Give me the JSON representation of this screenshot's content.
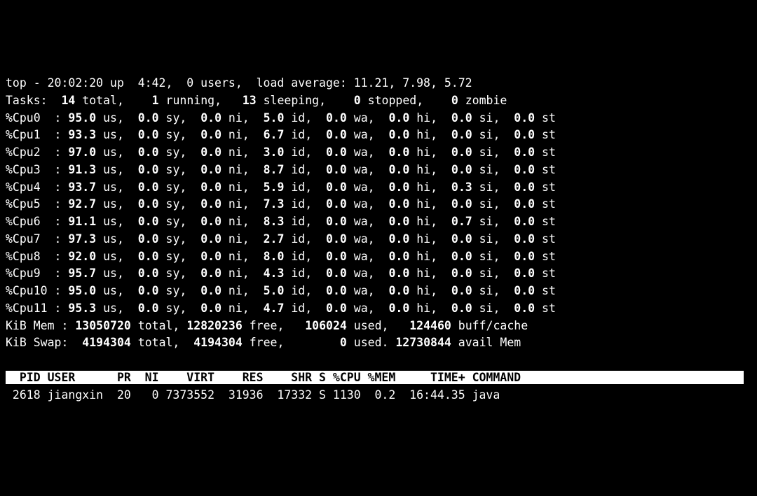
{
  "top_line": {
    "time": "20:02:20",
    "uptime": "4:42",
    "users": "0",
    "load1": "11.21",
    "load5": "7.98",
    "load15": "5.72"
  },
  "tasks": {
    "total": "14",
    "running": "1",
    "sleeping": "13",
    "stopped": "0",
    "zombie": "0"
  },
  "cpus": [
    {
      "name": "%Cpu0 ",
      "us": "95.0",
      "sy": "0.0",
      "ni": "0.0",
      "id": "5.0",
      "wa": "0.0",
      "hi": "0.0",
      "si": "0.0",
      "st": "0.0"
    },
    {
      "name": "%Cpu1 ",
      "us": "93.3",
      "sy": "0.0",
      "ni": "0.0",
      "id": "6.7",
      "wa": "0.0",
      "hi": "0.0",
      "si": "0.0",
      "st": "0.0"
    },
    {
      "name": "%Cpu2 ",
      "us": "97.0",
      "sy": "0.0",
      "ni": "0.0",
      "id": "3.0",
      "wa": "0.0",
      "hi": "0.0",
      "si": "0.0",
      "st": "0.0"
    },
    {
      "name": "%Cpu3 ",
      "us": "91.3",
      "sy": "0.0",
      "ni": "0.0",
      "id": "8.7",
      "wa": "0.0",
      "hi": "0.0",
      "si": "0.0",
      "st": "0.0"
    },
    {
      "name": "%Cpu4 ",
      "us": "93.7",
      "sy": "0.0",
      "ni": "0.0",
      "id": "5.9",
      "wa": "0.0",
      "hi": "0.0",
      "si": "0.3",
      "st": "0.0"
    },
    {
      "name": "%Cpu5 ",
      "us": "92.7",
      "sy": "0.0",
      "ni": "0.0",
      "id": "7.3",
      "wa": "0.0",
      "hi": "0.0",
      "si": "0.0",
      "st": "0.0"
    },
    {
      "name": "%Cpu6 ",
      "us": "91.1",
      "sy": "0.0",
      "ni": "0.0",
      "id": "8.3",
      "wa": "0.0",
      "hi": "0.0",
      "si": "0.7",
      "st": "0.0"
    },
    {
      "name": "%Cpu7 ",
      "us": "97.3",
      "sy": "0.0",
      "ni": "0.0",
      "id": "2.7",
      "wa": "0.0",
      "hi": "0.0",
      "si": "0.0",
      "st": "0.0"
    },
    {
      "name": "%Cpu8 ",
      "us": "92.0",
      "sy": "0.0",
      "ni": "0.0",
      "id": "8.0",
      "wa": "0.0",
      "hi": "0.0",
      "si": "0.0",
      "st": "0.0"
    },
    {
      "name": "%Cpu9 ",
      "us": "95.7",
      "sy": "0.0",
      "ni": "0.0",
      "id": "4.3",
      "wa": "0.0",
      "hi": "0.0",
      "si": "0.0",
      "st": "0.0"
    },
    {
      "name": "%Cpu10",
      "us": "95.0",
      "sy": "0.0",
      "ni": "0.0",
      "id": "5.0",
      "wa": "0.0",
      "hi": "0.0",
      "si": "0.0",
      "st": "0.0"
    },
    {
      "name": "%Cpu11",
      "us": "95.3",
      "sy": "0.0",
      "ni": "0.0",
      "id": "4.7",
      "wa": "0.0",
      "hi": "0.0",
      "si": "0.0",
      "st": "0.0"
    }
  ],
  "mem": {
    "label": "KiB Mem :",
    "total": "13050720",
    "free": "12820236",
    "used": "106024",
    "buffcache": "124460"
  },
  "swap": {
    "label": "KiB Swap:",
    "total": "4194304",
    "free": "4194304",
    "used": "0",
    "avail": "12730844"
  },
  "header": {
    "pid": "PID",
    "user": "USER",
    "pr": "PR",
    "ni": "NI",
    "virt": "VIRT",
    "res": "RES",
    "shr": "SHR",
    "s": "S",
    "cpu": "%CPU",
    "mem": "%MEM",
    "time": "TIME+",
    "cmd": "COMMAND"
  },
  "processes": [
    {
      "pid": "2618",
      "user": "jiangxin",
      "pr": "20",
      "ni": "0",
      "virt": "7373552",
      "res": "31936",
      "shr": "17332",
      "s": "S",
      "cpu": "1130",
      "mem": "0.2",
      "time": "16:44.35",
      "cmd": "java"
    }
  ]
}
